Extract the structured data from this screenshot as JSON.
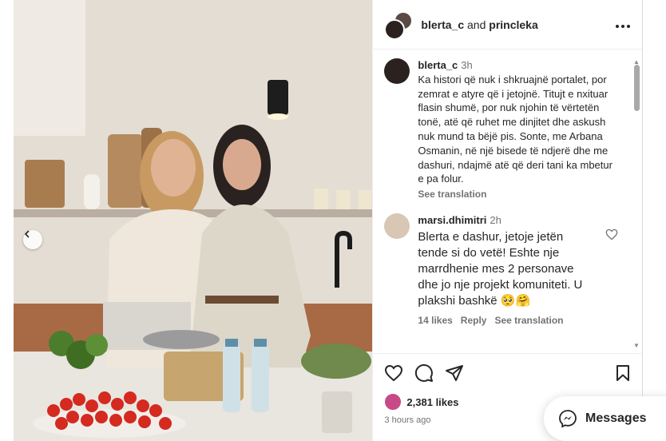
{
  "post": {
    "authors_line_user1": "blerta_c",
    "authors_line_and": "and",
    "authors_line_user2": "princleka"
  },
  "caption": {
    "username": "blerta_c",
    "time": "3h",
    "text": "Ka histori që nuk i shkruajnë portalet, por zemrat e atyre që i jetojnë. Titujt e nxituar flasin shumë, por nuk njohin të vërtetën tonë, atë që ruhet me dinjitet dhe askush nuk mund ta bëjë pis. Sonte, me Arbana Osmanin, në një bisede të ndjerë dhe me dashuri, ndajmë atë që deri tani ka mbetur e pa folur.",
    "see_translation": "See translation"
  },
  "comment": {
    "username": "marsi.dhimitri",
    "time": "2h",
    "text": "Blerta e dashur, jetoje jetën tende si do vetë! Eshte nje marrdhenie mes 2 personave dhe jo nje projekt komuniteti. U plakshi bashkë 🥺🤗",
    "likes": "14 likes",
    "reply": "Reply",
    "see_translation": "See translation"
  },
  "footer": {
    "likes": "2,381 likes",
    "time_ago": "3 hours ago"
  },
  "messages": {
    "label": "Messages"
  },
  "icons": {
    "like": "heart-icon",
    "comment": "comment-bubble-icon",
    "share": "paper-plane-icon",
    "save": "bookmark-icon",
    "more": "more-horizontal-icon",
    "prev": "chevron-left-icon",
    "messenger": "messenger-icon"
  },
  "colors": {
    "text": "#262626",
    "secondary": "#737373",
    "border": "#dbdbdb"
  }
}
